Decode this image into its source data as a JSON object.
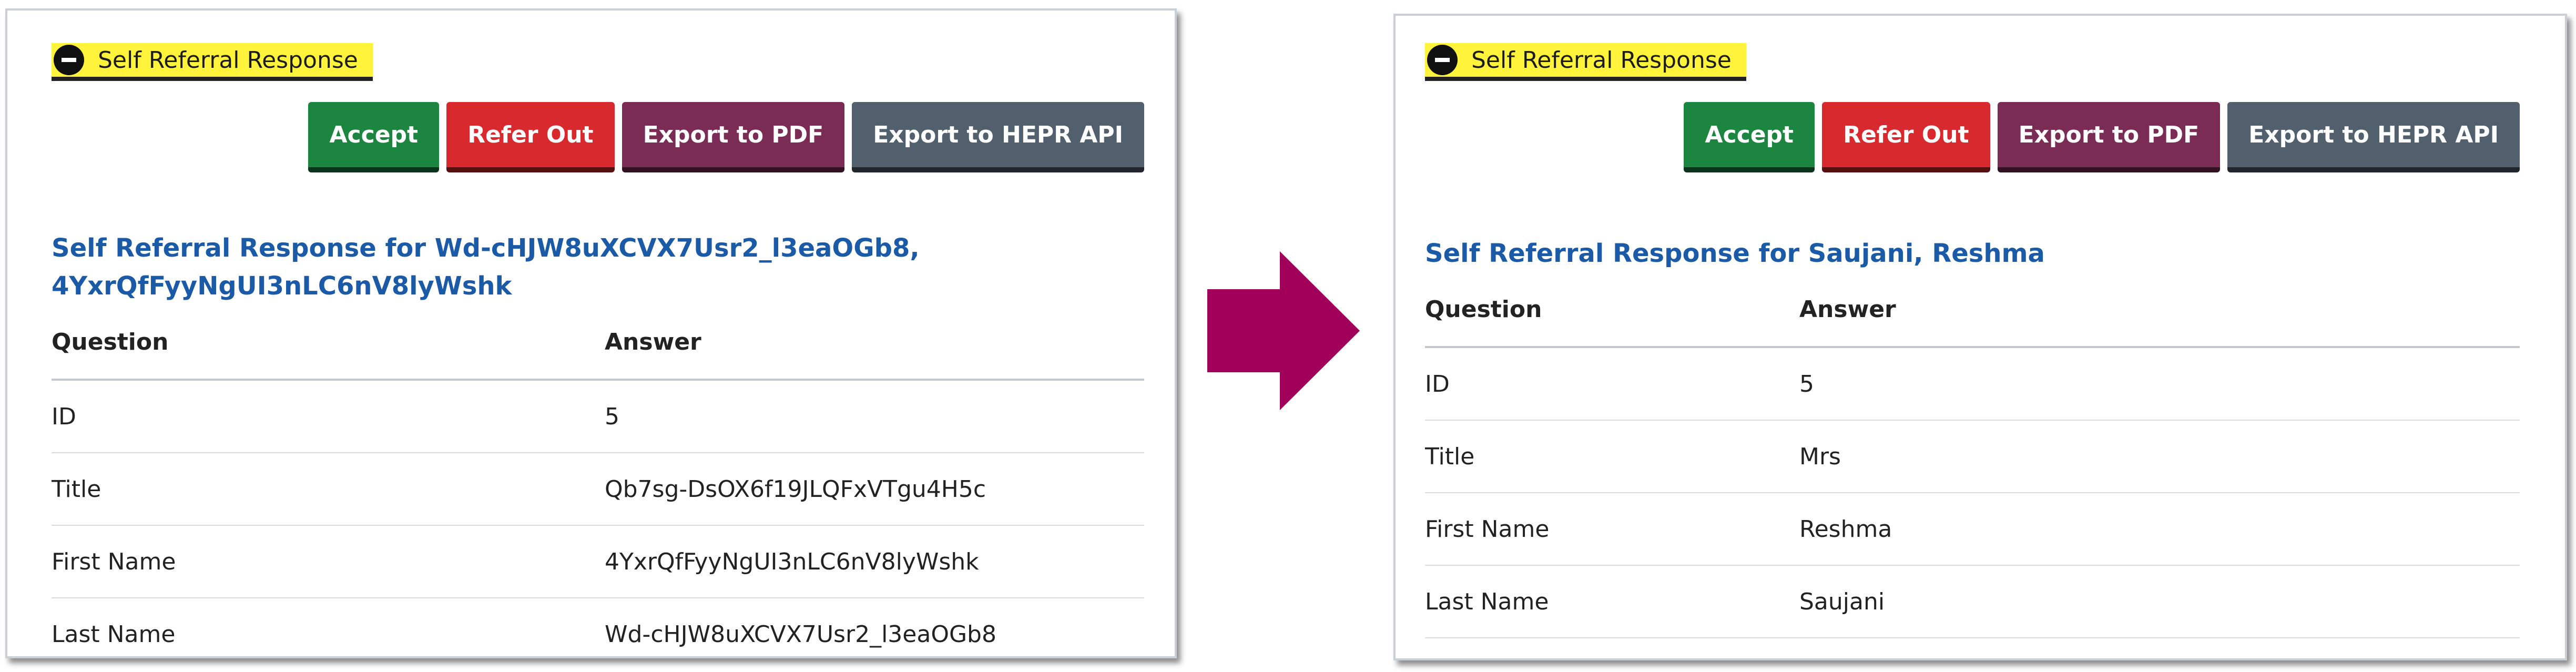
{
  "colors": {
    "toggle_background": "#fff33b",
    "accept": "#1c8641",
    "refer_out": "#d8292f",
    "export_pdf": "#7b2c55",
    "export_hepr": "#52606d",
    "heading": "#1a5aa6",
    "arrow": "#a0005a"
  },
  "before": {
    "toggle_label": "Self Referral Response",
    "toggle_icon": "minus-circle-icon",
    "buttons": {
      "accept": "Accept",
      "refer_out": "Refer Out",
      "export_pdf": "Export to PDF",
      "export_hepr": "Export to HEPR API"
    },
    "heading_line1": "Self Referral Response for Wd-cHJW8uXCVX7Usr2_l3eaOGb8,",
    "heading_line2": "4YxrQfFyyNgUI3nLC6nV8lyWshk",
    "table": {
      "headers": {
        "question": "Question",
        "answer": "Answer"
      },
      "rows": [
        {
          "question": "ID",
          "answer": "5"
        },
        {
          "question": "Title",
          "answer": "Qb7sg-DsOX6f19JLQFxVTgu4H5c"
        },
        {
          "question": "First Name",
          "answer": "4YxrQfFyyNgUI3nLC6nV8lyWshk"
        },
        {
          "question": "Last Name",
          "answer": "Wd-cHJW8uXCVX7Usr2_l3eaOGb8"
        }
      ]
    }
  },
  "arrow_icon": "right-arrow-icon",
  "after": {
    "toggle_label": "Self Referral Response",
    "toggle_icon": "minus-circle-icon",
    "buttons": {
      "accept": "Accept",
      "refer_out": "Refer Out",
      "export_pdf": "Export to PDF",
      "export_hepr": "Export to HEPR API"
    },
    "heading": "Self Referral Response for Saujani, Reshma",
    "table": {
      "headers": {
        "question": "Question",
        "answer": "Answer"
      },
      "rows": [
        {
          "question": "ID",
          "answer": "5"
        },
        {
          "question": "Title",
          "answer": "Mrs"
        },
        {
          "question": "First Name",
          "answer": "Reshma"
        },
        {
          "question": "Last Name",
          "answer": "Saujani"
        }
      ]
    }
  }
}
